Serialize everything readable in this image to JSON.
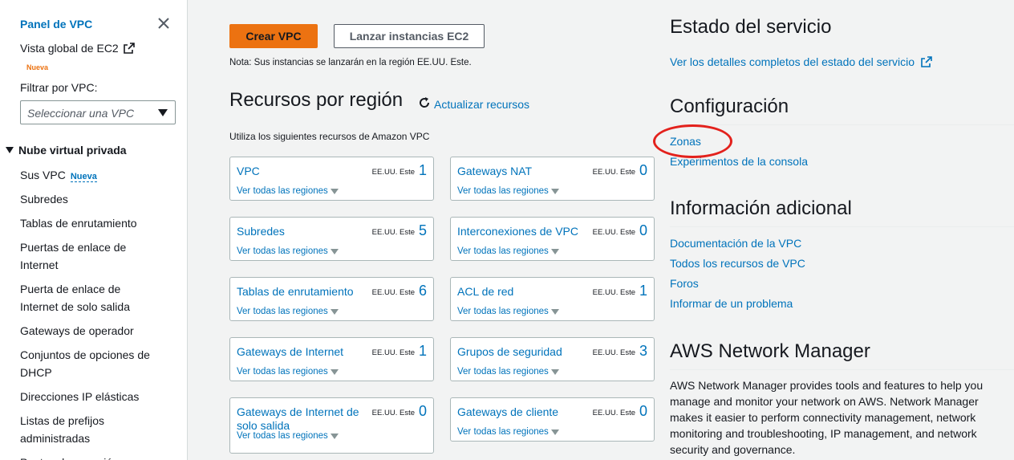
{
  "sidebar": {
    "title": "Panel de VPC",
    "global_view": "Vista global de EC2",
    "global_badge": "Nueva",
    "filter_label": "Filtrar por VPC:",
    "filter_placeholder": "Seleccionar una VPC",
    "section": "Nube virtual privada",
    "items": [
      {
        "label": "Sus VPC",
        "badge": "Nueva"
      },
      {
        "label": "Subredes"
      },
      {
        "label": "Tablas de enrutamiento"
      },
      {
        "label": "Puertas de enlace de Internet"
      },
      {
        "label": "Puerta de enlace de Internet de solo salida"
      },
      {
        "label": "Gateways de operador"
      },
      {
        "label": "Conjuntos de opciones de DHCP"
      },
      {
        "label": "Direcciones IP elásticas"
      },
      {
        "label": "Listas de prefijos administradas"
      },
      {
        "label": "Puntos de conexión"
      }
    ]
  },
  "main": {
    "create_vpc": "Crear VPC",
    "launch_ec2": "Lanzar instancias EC2",
    "note": "Nota: Sus instancias se lanzarán en la región EE.UU. Este.",
    "resources_heading": "Recursos por región",
    "refresh_label": "Actualizar recursos",
    "usage_text": "Utiliza los siguientes recursos de Amazon VPC",
    "view_all": "Ver todas las regiones",
    "region": "EE.UU. Este",
    "cards": [
      {
        "title": "VPC",
        "count": "1"
      },
      {
        "title": "Gateways NAT",
        "count": "0"
      },
      {
        "title": "Subredes",
        "count": "5"
      },
      {
        "title": "Interconexiones de VPC",
        "count": "0"
      },
      {
        "title": "Tablas de enrutamiento",
        "count": "6"
      },
      {
        "title": "ACL de red",
        "count": "1"
      },
      {
        "title": "Gateways de Internet",
        "count": "1"
      },
      {
        "title": "Grupos de seguridad",
        "count": "3"
      },
      {
        "title": "Gateways de Internet de solo salida",
        "count": "0"
      },
      {
        "title": "Gateways de cliente",
        "count": "0"
      }
    ]
  },
  "right": {
    "service_health_heading": "Estado del servicio",
    "service_health_link": "Ver los detalles completos del estado del servicio",
    "settings_heading": "Configuración",
    "settings_links": [
      "Zonas",
      "Experimentos de la consola"
    ],
    "additional_heading": "Información adicional",
    "additional_links": [
      "Documentación de la VPC",
      "Todos los recursos de VPC",
      "Foros",
      "Informar de un problema"
    ],
    "network_manager_heading": "AWS Network Manager",
    "network_manager_text": "AWS Network Manager provides tools and features to help you manage and monitor your network on AWS. Network Manager makes it easier to perform connectivity management, network monitoring and troubleshooting, IP management, and network security and governance."
  },
  "colors": {
    "link": "#0073bb",
    "primary_button": "#ec7211",
    "new_badge_orange": "#ec7211",
    "annotation_circle": "#e3211c"
  }
}
